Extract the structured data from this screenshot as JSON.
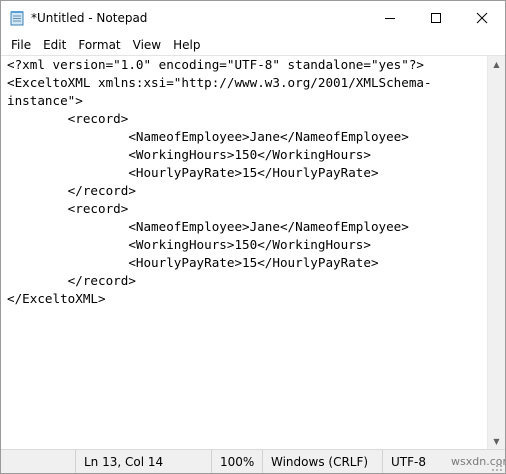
{
  "window": {
    "title": "*Untitled - Notepad"
  },
  "menu": [
    "File",
    "Edit",
    "Format",
    "View",
    "Help"
  ],
  "editor": {
    "lines": [
      "<?xml version=\"1.0\" encoding=\"UTF-8\" standalone=\"yes\"?>",
      "<ExceltoXML xmlns:xsi=\"http://www.w3.org/2001/XMLSchema-",
      "instance\">",
      "        <record>",
      "                <NameofEmployee>Jane</NameofEmployee>",
      "                <WorkingHours>150</WorkingHours>",
      "                <HourlyPayRate>15</HourlyPayRate>",
      "        </record>",
      "        <record>",
      "                <NameofEmployee>Jane</NameofEmployee>",
      "                <WorkingHours>150</WorkingHours>",
      "                <HourlyPayRate>15</HourlyPayRate>",
      "        </record>",
      "</ExceltoXML>"
    ]
  },
  "status": {
    "position": "Ln 13, Col 14",
    "zoom": "100%",
    "line_ending": "Windows (CRLF)",
    "encoding": "UTF-8"
  },
  "watermark": "wsxdn.com"
}
